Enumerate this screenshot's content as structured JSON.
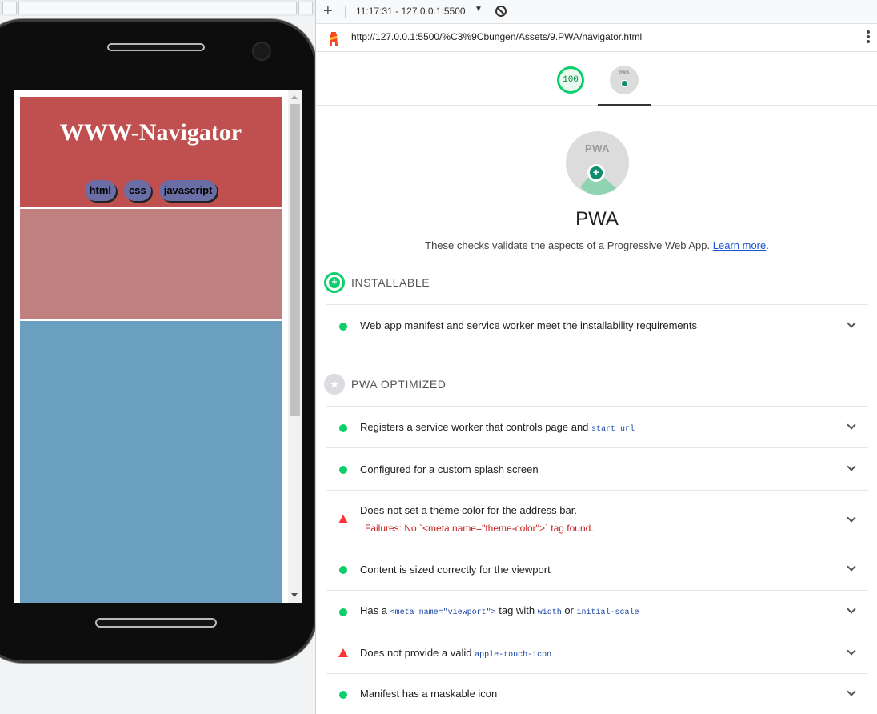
{
  "devtools": {
    "toolbar": {
      "add_label": "+",
      "report_select": "11:17:31 - 127.0.0.1:5500",
      "report_caret": "▼"
    },
    "url": "http://127.0.0.1:5500/%C3%9Cbungen/Assets/9.PWA/navigator.html",
    "gauges": {
      "score": "100",
      "pwa_badge_text": "PWA"
    },
    "category": {
      "badge_text": "PWA",
      "badge_plus": "+",
      "title": "PWA",
      "description": "These checks validate the aspects of a Progressive Web App.",
      "learn_more": "Learn more",
      "period": "."
    },
    "groups": {
      "installable": {
        "title": "INSTALLABLE",
        "icon": "plus-circle-icon",
        "icon_glyph": "+",
        "color": "#0cce6b"
      },
      "optimized": {
        "title": "PWA OPTIMIZED",
        "icon": "star-icon",
        "icon_glyph": "★",
        "color": "#dadce0"
      }
    },
    "audits": [
      {
        "status": "pass",
        "title": "Web app manifest and service worker meet the installability requirements"
      },
      {
        "status": "pass",
        "title": "Registers a service worker that controls page and",
        "code": "start_url"
      },
      {
        "status": "pass",
        "title": "Configured for a custom splash screen"
      },
      {
        "status": "fail",
        "title": "Does not set a theme color for the address bar.",
        "failure": "Failures: No `<meta name=\"theme-color\">` tag found."
      },
      {
        "status": "pass",
        "title": "Content is sized correctly for the viewport"
      },
      {
        "status": "pass",
        "title_pre": "Has a",
        "code1": "<meta name=\"viewport\">",
        "title_mid": "tag with",
        "code2": "width",
        "title_or": "or",
        "code3": "initial-scale"
      },
      {
        "status": "fail",
        "title": "Does not provide a valid",
        "code": "apple-touch-icon"
      },
      {
        "status": "pass",
        "title": "Manifest has a maskable icon"
      }
    ],
    "colors": {
      "pass": "#0cce6b",
      "fail": "#ff3333"
    }
  },
  "device": {
    "site_title": "WWW-Navigator",
    "nav": [
      "html",
      "css",
      "javascript"
    ],
    "colors": {
      "header": "#c05050",
      "section2": "#c08080",
      "section3": "#6a9fc0",
      "nav_pill": "#6b6ea5"
    }
  }
}
